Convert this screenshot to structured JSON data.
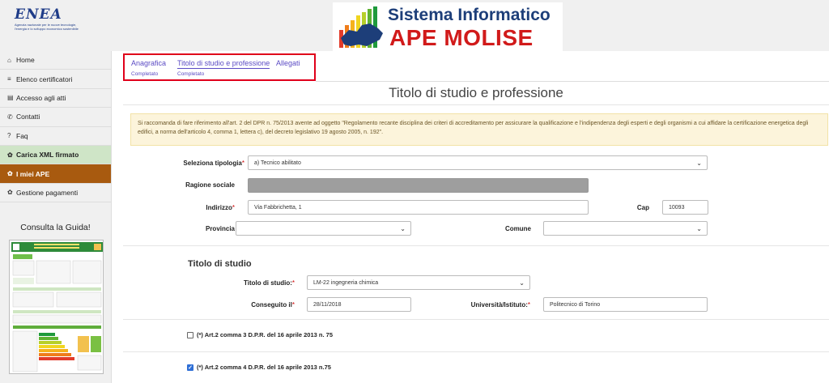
{
  "header": {
    "enea_word": "ENEA",
    "enea_sub": "Agenzia nazionale per le nuove tecnologie, l'energia e lo sviluppo economico sostenibile",
    "banner_line1": "Sistema Informatico",
    "banner_line2": "APE MOLISE"
  },
  "sidebar": {
    "items": [
      {
        "icon": "home-icon",
        "glyph": "⌂",
        "label": "Home"
      },
      {
        "icon": "list-icon",
        "glyph": "≡",
        "label": "Elenco certificatori"
      },
      {
        "icon": "file-icon",
        "glyph": "▤",
        "label": "Accesso agli atti"
      },
      {
        "icon": "phone-icon",
        "glyph": "✆",
        "label": "Contatti"
      },
      {
        "icon": "question-icon",
        "glyph": "?",
        "label": "Faq"
      },
      {
        "icon": "gear-icon",
        "glyph": "✿",
        "label": "Carica XML firmato"
      },
      {
        "icon": "gear-icon",
        "glyph": "✿",
        "label": "I miei APE"
      },
      {
        "icon": "gear-icon",
        "glyph": "✿",
        "label": "Gestione pagamenti"
      }
    ],
    "guide_title": "Consulta la Guida!"
  },
  "tabs": [
    {
      "label": "Anagrafica",
      "status": "Completato"
    },
    {
      "label": "Titolo di studio e professione",
      "status": "Completato"
    },
    {
      "label": "Allegati",
      "status": ""
    }
  ],
  "page_title": "Titolo di studio e professione",
  "notice": "Si raccomanda di fare riferimento all'art. 2 del DPR n. 75/2013 avente ad oggetto \"Regolamento recante disciplina dei criteri di accreditamento per assicurare la qualificazione e l'indipendenza degli esperti e degli organismi a cui affidare la certificazione energetica degli edifici, a norma dell'articolo 4, comma 1, lettera c), del decreto legislativo 19 agosto 2005, n. 192\".",
  "form": {
    "tipologia_label": "Seleziona tipologia",
    "tipologia_value": "a) Tecnico abilitato",
    "ragione_label": "Ragione sociale",
    "indirizzo_label": "Indirizzo",
    "indirizzo_value": "Via Fabbrichetta, 1",
    "cap_label": "Cap",
    "cap_value": "10093",
    "provincia_label": "Provincia",
    "comune_label": "Comune",
    "titolo_section": "Titolo di studio",
    "titolo_label": "Titolo di studio:",
    "titolo_value": "LM-22 ingegneria chimica",
    "conseguito_label": "Conseguito il",
    "conseguito_value": "28/11/2018",
    "universita_label": "Università/Istituto:",
    "universita_value": "Politecnico di Torino",
    "required_mark": "*",
    "art2c3_label": "(*) Art.2 comma 3 D.P.R. del 16 aprile 2013 n. 75",
    "art2c3_checked": false,
    "art2c4_label": "(*) Art.2 comma 4 D.P.R. del 16 aprile 2013 n.75",
    "art2c4_checked": true
  },
  "colors": {
    "accent": "#5b4bc4",
    "highlight_border": "#e0001a",
    "active_nav": "#a85a0f",
    "xml_nav": "#cfe5c7"
  }
}
